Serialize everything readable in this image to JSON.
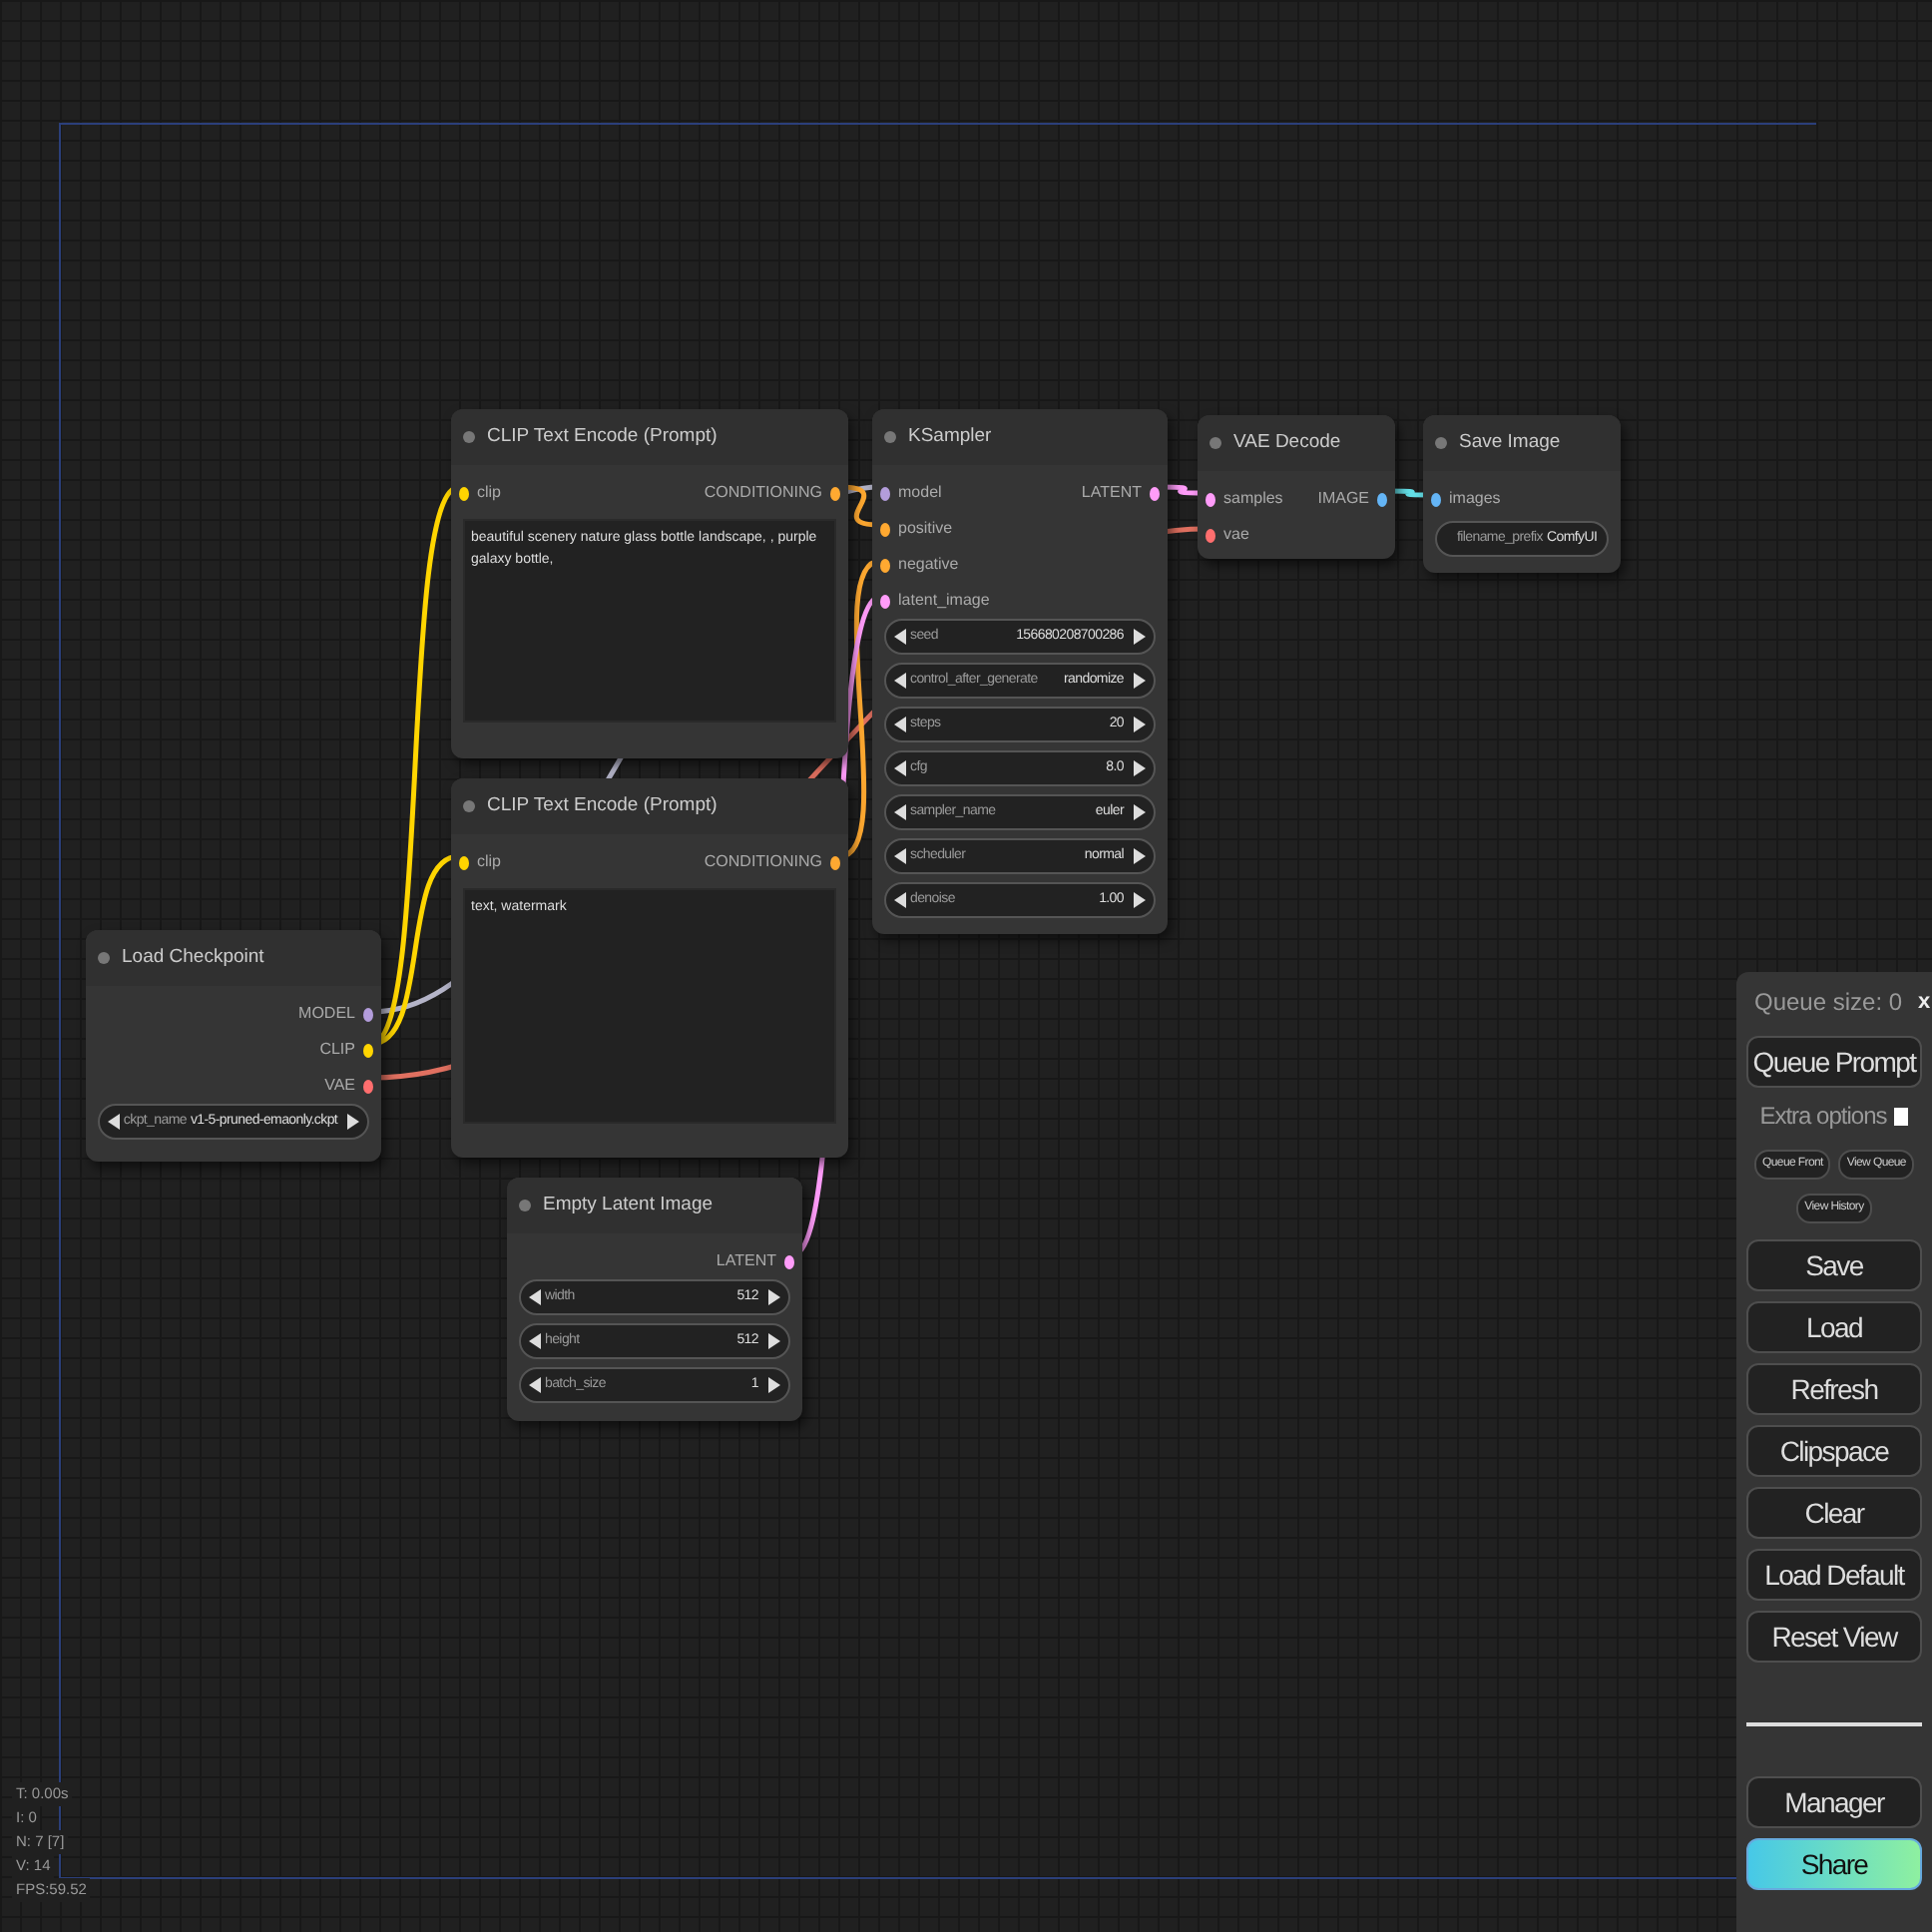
{
  "nodes": [
    {
      "title": "CLIP Text Encode (Prompt)",
      "inputs": [
        {
          "label": "clip",
          "color": "#ffd500"
        }
      ],
      "outputs": [
        {
          "label": "CONDITIONING",
          "color": "#ffa931"
        }
      ],
      "prompt": "beautiful scenery nature glass bottle landscape, , purple galaxy bottle,"
    },
    {
      "title": "CLIP Text Encode (Prompt)",
      "inputs": [
        {
          "label": "clip",
          "color": "#ffd500"
        }
      ],
      "outputs": [
        {
          "label": "CONDITIONING",
          "color": "#ffa931"
        }
      ],
      "prompt": "text, watermark"
    },
    {
      "title": "KSampler",
      "inputs": [
        {
          "label": "model",
          "color": "#b39ddb"
        },
        {
          "label": "positive",
          "color": "#ffa931"
        },
        {
          "label": "negative",
          "color": "#ffa931"
        },
        {
          "label": "latent_image",
          "color": "#ff9cf9"
        }
      ],
      "outputs": [
        {
          "label": "LATENT",
          "color": "#ff9cf9"
        }
      ],
      "widgets": [
        {
          "kind": "stepper",
          "label": "seed",
          "value": "156680208700286"
        },
        {
          "kind": "stepper",
          "label": "control_after_generate",
          "value": "randomize"
        },
        {
          "kind": "stepper",
          "label": "steps",
          "value": "20"
        },
        {
          "kind": "stepper",
          "label": "cfg",
          "value": "8.0"
        },
        {
          "kind": "stepper",
          "label": "sampler_name",
          "value": "euler"
        },
        {
          "kind": "stepper",
          "label": "scheduler",
          "value": "normal"
        },
        {
          "kind": "stepper",
          "label": "denoise",
          "value": "1.00"
        }
      ]
    },
    {
      "title": "VAE Decode",
      "inputs": [
        {
          "label": "samples",
          "color": "#ff9cf9"
        },
        {
          "label": "vae",
          "color": "#ff6e6e"
        }
      ],
      "outputs": [
        {
          "label": "IMAGE",
          "color": "#64b5f6"
        }
      ]
    },
    {
      "title": "Save Image",
      "inputs": [
        {
          "label": "images",
          "color": "#64b5f6"
        }
      ],
      "widgets": [
        {
          "kind": "text",
          "label": "filename_prefix",
          "value": "ComfyUI"
        }
      ]
    },
    {
      "title": "Load Checkpoint",
      "outputs": [
        {
          "label": "MODEL",
          "color": "#b39ddb"
        },
        {
          "label": "CLIP",
          "color": "#ffd500"
        },
        {
          "label": "VAE",
          "color": "#ff6e6e"
        }
      ],
      "widgets": [
        {
          "kind": "stepper",
          "label": "ckpt_name",
          "value": "v1-5-pruned-emaonly.ckpt"
        }
      ]
    },
    {
      "title": "Empty Latent Image",
      "outputs": [
        {
          "label": "LATENT",
          "color": "#ff9cf9"
        }
      ],
      "widgets": [
        {
          "kind": "stepper",
          "label": "width",
          "value": "512"
        },
        {
          "kind": "stepper",
          "label": "height",
          "value": "512"
        },
        {
          "kind": "stepper",
          "label": "batch_size",
          "value": "1"
        }
      ]
    }
  ],
  "menu": {
    "queue_size": "Queue size: 0",
    "close": "x",
    "queue_button": "Queue Prompt",
    "extra_options": {
      "label": "Extra options",
      "checked": false
    },
    "small_buttons": [
      "Queue Front",
      "View Queue"
    ],
    "history_button": "View History",
    "buttons": [
      {
        "kind": "plain",
        "label": "Save"
      },
      {
        "kind": "plain",
        "label": "Load"
      },
      {
        "kind": "plain",
        "label": "Refresh"
      },
      {
        "kind": "plain",
        "label": "Clipspace"
      },
      {
        "kind": "plain",
        "label": "Clear"
      },
      {
        "kind": "plain",
        "label": "Load Default"
      },
      {
        "kind": "plain",
        "label": "Reset View"
      }
    ],
    "bottom_buttons": [
      {
        "kind": "plain",
        "label": "Manager"
      },
      {
        "kind": "share",
        "label": "Share"
      }
    ]
  },
  "stats": [
    "T: 0.00s",
    "I: 0",
    "N: 7 [7]",
    "V: 14",
    "FPS:59.52"
  ]
}
